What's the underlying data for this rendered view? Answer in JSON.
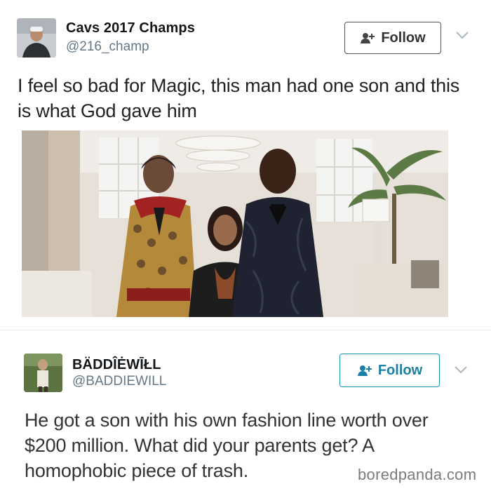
{
  "tweets": [
    {
      "display_name": "Cavs 2017 Champs",
      "handle": "@216_champ",
      "follow_label": "Follow",
      "text": "I feel so bad for Magic, this man had one son and this is what God gave him",
      "avatar_icon": "user-avatar",
      "follow_icon": "add-user-icon",
      "chevron_icon": "chevron-down-icon"
    },
    {
      "display_name": "BÄDDÎĖWĪŁL",
      "handle": "@BADDIEWILL",
      "follow_label": "Follow",
      "text": "He got a son with his own fashion line worth over $200 million. What did your parents get? A homophobic piece of trash.",
      "avatar_icon": "user-avatar",
      "follow_icon": "add-user-icon",
      "chevron_icon": "chevron-down-icon"
    }
  ],
  "watermark": "boredpanda.com",
  "colors": {
    "follow_border_1": "#555555",
    "follow_border_2": "#1b95b0",
    "follow_text_2": "#1c7fa6",
    "handle": "#657786"
  }
}
